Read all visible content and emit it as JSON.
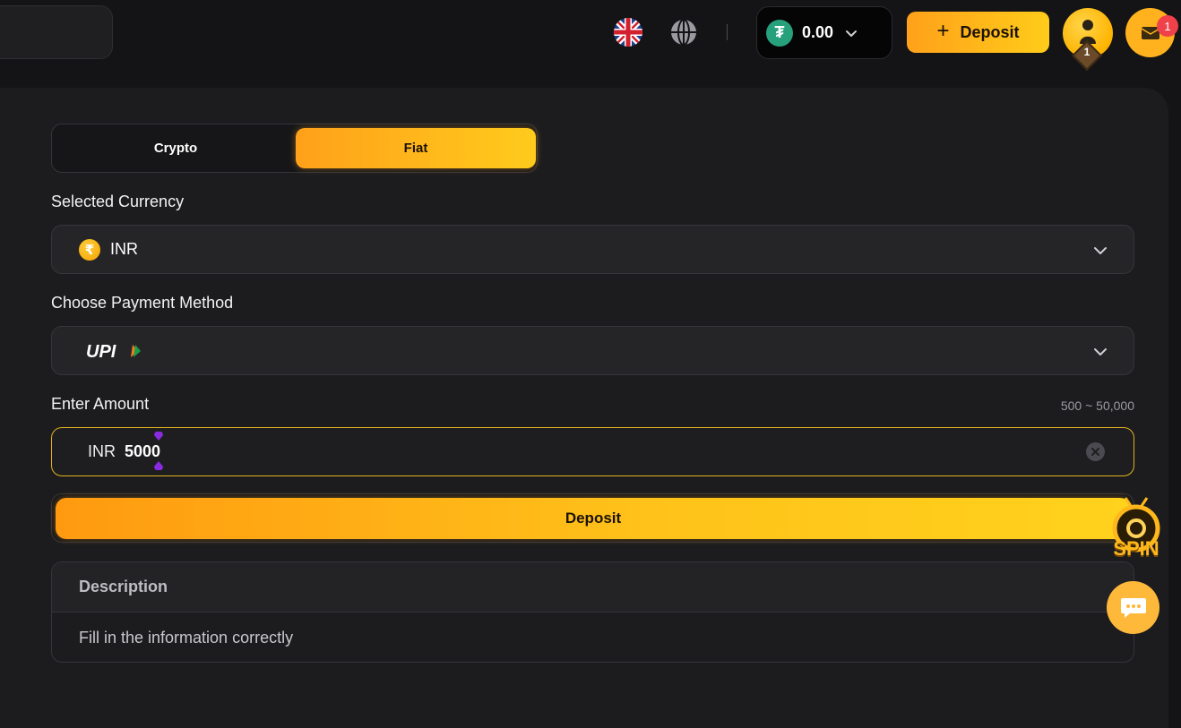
{
  "header": {
    "language_icon": "uk-flag-icon",
    "region_icon": "globe-icon",
    "wallet": {
      "currency_icon": "tether-icon",
      "currency_symbol": "₮",
      "balance": "0.00"
    },
    "deposit_label": "Deposit",
    "level": "1",
    "inbox_count": "1"
  },
  "tabs": [
    {
      "label": "Crypto",
      "active": false
    },
    {
      "label": "Fiat",
      "active": true
    }
  ],
  "form": {
    "currency_label": "Selected Currency",
    "currency_symbol": "₹",
    "currency_value": "INR",
    "payment_label": "Choose Payment Method",
    "payment_value": "UPI",
    "amount_label": "Enter Amount",
    "amount_range": "500 ~ 50,000",
    "amount_prefix": "INR",
    "amount_value": "5000",
    "deposit_label": "Deposit"
  },
  "description": {
    "title": "Description",
    "text": "Fill in the information correctly"
  },
  "widgets": {
    "spin_label": "SPIN",
    "chat_icon": "chat-bubble-icon"
  },
  "colors": {
    "accent_start": "#ffa11a",
    "accent_end": "#ffcc1a",
    "background": "#141416",
    "panel": "#1c1c1f",
    "amount_border": "#e3b21e",
    "tether": "#26a17b",
    "badge": "#f0414a"
  }
}
